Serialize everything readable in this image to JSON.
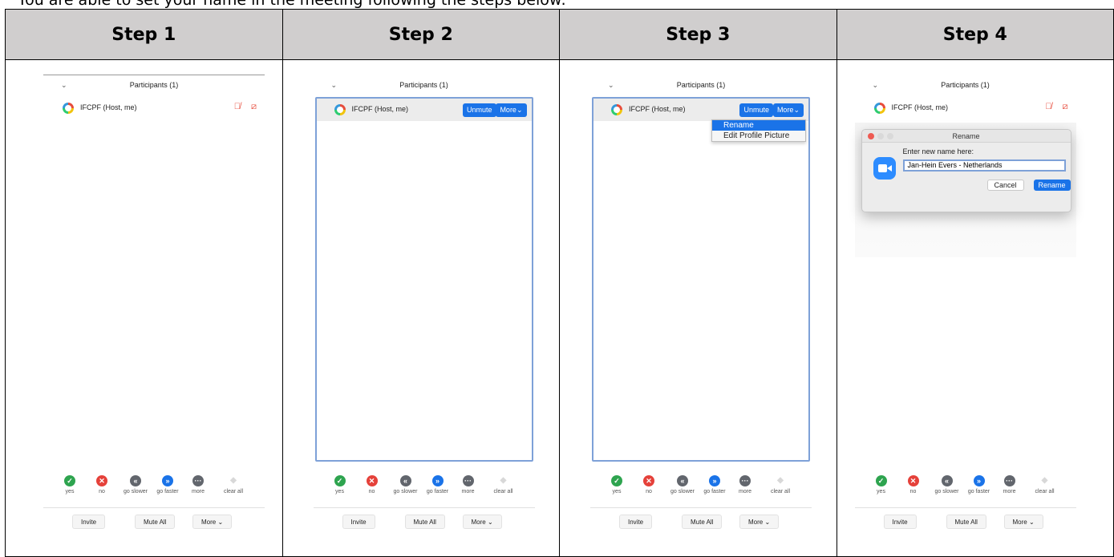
{
  "intro": "You are able to set your name in the meeting following the steps below:",
  "steps": [
    "Step 1",
    "Step 2",
    "Step 3",
    "Step 4"
  ],
  "panel": {
    "title": "Participants (1)",
    "participant": "IFCPF (Host, me)",
    "unmute": "Unmute",
    "more_btn": "More",
    "reactions": [
      "yes",
      "no",
      "go slower",
      "go faster",
      "more",
      "clear all"
    ],
    "footer": {
      "invite": "Invite",
      "mute_all": "Mute All",
      "more": "More"
    }
  },
  "menu": {
    "rename": "Rename",
    "edit_picture": "Edit Profile Picture"
  },
  "dialog": {
    "title": "Rename",
    "label": "Enter new name here:",
    "value": "Jan-Hein Evers - Netherlands",
    "cancel": "Cancel",
    "ok": "Rename"
  }
}
